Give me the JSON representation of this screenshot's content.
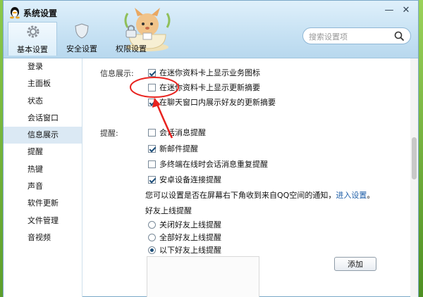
{
  "window": {
    "title": "系统设置"
  },
  "tabs": [
    {
      "label": "基本设置",
      "icon": "gear-icon"
    },
    {
      "label": "安全设置",
      "icon": "shield-icon"
    },
    {
      "label": "权限设置",
      "icon": "lock-icon"
    }
  ],
  "search": {
    "placeholder": "搜索设置项"
  },
  "sidebar": {
    "items": [
      "登录",
      "主面板",
      "状态",
      "会话窗口",
      "信息展示",
      "提醒",
      "热键",
      "声音",
      "软件更新",
      "文件管理",
      "音视频"
    ],
    "active_index": 4
  },
  "info_display": {
    "label": "信息展示:",
    "options": [
      {
        "label": "在迷你资料卡上显示业务图标",
        "checked": true
      },
      {
        "label": "在迷你资料卡上显示更新摘要",
        "checked": false
      },
      {
        "label": "在聊天窗口内展示好友的更新摘要",
        "checked": true
      }
    ]
  },
  "reminders": {
    "label": "提醒:",
    "options": [
      {
        "label": "会话消息提醒",
        "checked": false
      },
      {
        "label": "新邮件提醒",
        "checked": true
      },
      {
        "label": "多终端在线时会话消息重复提醒",
        "checked": false
      },
      {
        "label": "安卓设备连接提醒",
        "checked": true
      }
    ],
    "notice_text": "您可以设置是否在屏幕右下角收到来自QQ空间的通知，",
    "notice_link": "进入设置",
    "notice_end": "。"
  },
  "friend_online": {
    "label": "好友上线提醒",
    "options": [
      {
        "label": "关闭好友上线提醒",
        "checked": false
      },
      {
        "label": "全部好友上线提醒",
        "checked": false
      },
      {
        "label": "以下好友上线提醒",
        "checked": true
      }
    ],
    "add_button": "添加"
  },
  "colors": {
    "accent": "#1f5fa8",
    "annotation": "#e8231f",
    "titlebar": "#c6e1f3"
  }
}
